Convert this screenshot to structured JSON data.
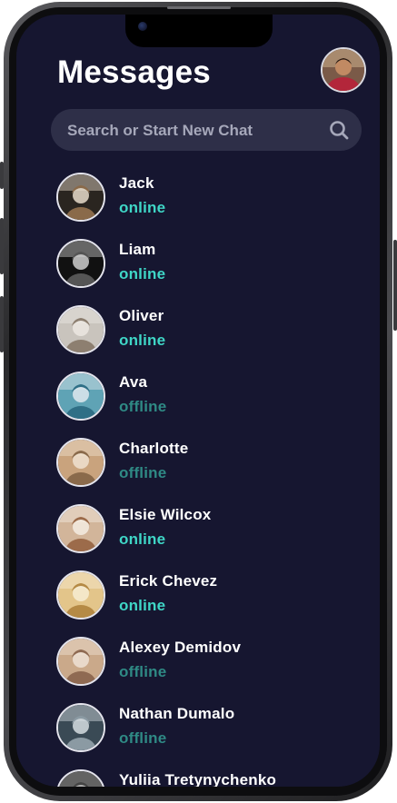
{
  "header": {
    "title": "Messages"
  },
  "search": {
    "placeholder": "Search or Start New Chat"
  },
  "colors": {
    "background": "#161630",
    "online": "#3fd6c6",
    "offline": "#2f8a85",
    "search_bg": "#2e2f48"
  },
  "contacts": [
    {
      "name": "Jack",
      "status": "online",
      "avatar": [
        "#2a2520",
        "#8a6a4a",
        "#e8dccb"
      ]
    },
    {
      "name": "Liam",
      "status": "online",
      "avatar": [
        "#111111",
        "#555555",
        "#cfcfcf"
      ]
    },
    {
      "name": "Oliver",
      "status": "online",
      "avatar": [
        "#c9c4bd",
        "#8d7f70",
        "#ece8e2"
      ]
    },
    {
      "name": "Ava",
      "status": "offline",
      "avatar": [
        "#5fa3b5",
        "#2f6f86",
        "#dfe9ee"
      ]
    },
    {
      "name": "Charlotte",
      "status": "offline",
      "avatar": [
        "#c9a37d",
        "#8a6a4b",
        "#f0e2d0"
      ]
    },
    {
      "name": "Elsie Wilcox",
      "status": "online",
      "avatar": [
        "#d2b59a",
        "#9c6b4a",
        "#f5ece2"
      ]
    },
    {
      "name": "Erick Chevez",
      "status": "online",
      "avatar": [
        "#e3c58a",
        "#b58a45",
        "#f7ecd2"
      ]
    },
    {
      "name": "Alexey Demidov",
      "status": "offline",
      "avatar": [
        "#caa98a",
        "#8f6a52",
        "#efe2d5"
      ]
    },
    {
      "name": "Nathan Dumalo",
      "status": "offline",
      "avatar": [
        "#3a4a55",
        "#8b9aa3",
        "#d6dde2"
      ]
    },
    {
      "name": "Yuliia Tretynychenko",
      "status": "",
      "avatar": [
        "#1a1a1a",
        "#444444",
        "#bcbcbc"
      ]
    }
  ]
}
